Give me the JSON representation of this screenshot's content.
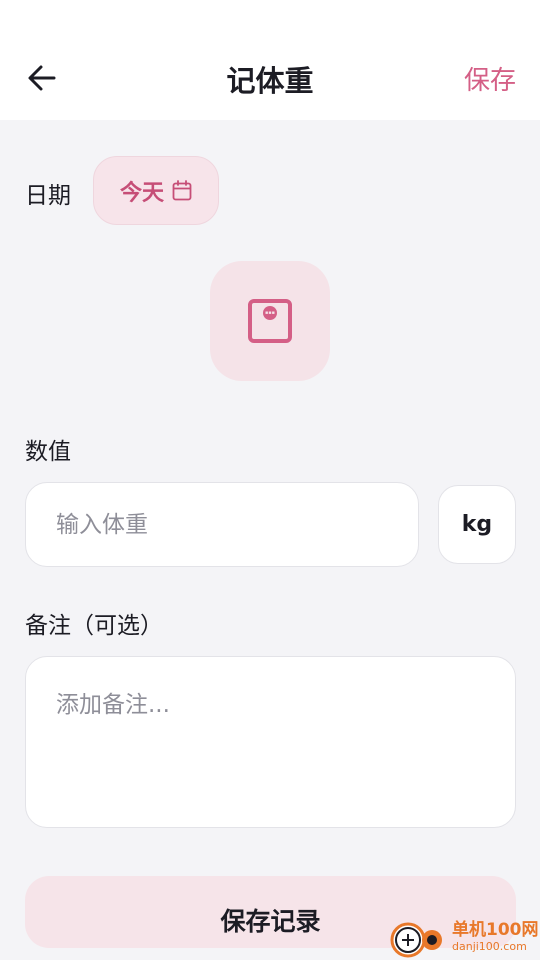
{
  "header": {
    "title": "记体重",
    "save_label": "保存"
  },
  "date": {
    "label": "日期",
    "value": "今天"
  },
  "weight": {
    "label": "数值",
    "placeholder": "输入体重",
    "unit": "kg"
  },
  "note": {
    "label": "备注（可选）",
    "placeholder": "添加备注..."
  },
  "footer": {
    "save_record_label": "保存记录"
  },
  "watermark": {
    "brand": "单机100网",
    "domain": "danji100.com"
  },
  "colors": {
    "accent": "#d45f86",
    "chip_background": "#f7e4ea",
    "page_background": "#f4f4f7"
  },
  "icons": {
    "back": "arrow-left-icon",
    "calendar": "calendar-icon",
    "scale": "scale-icon"
  }
}
